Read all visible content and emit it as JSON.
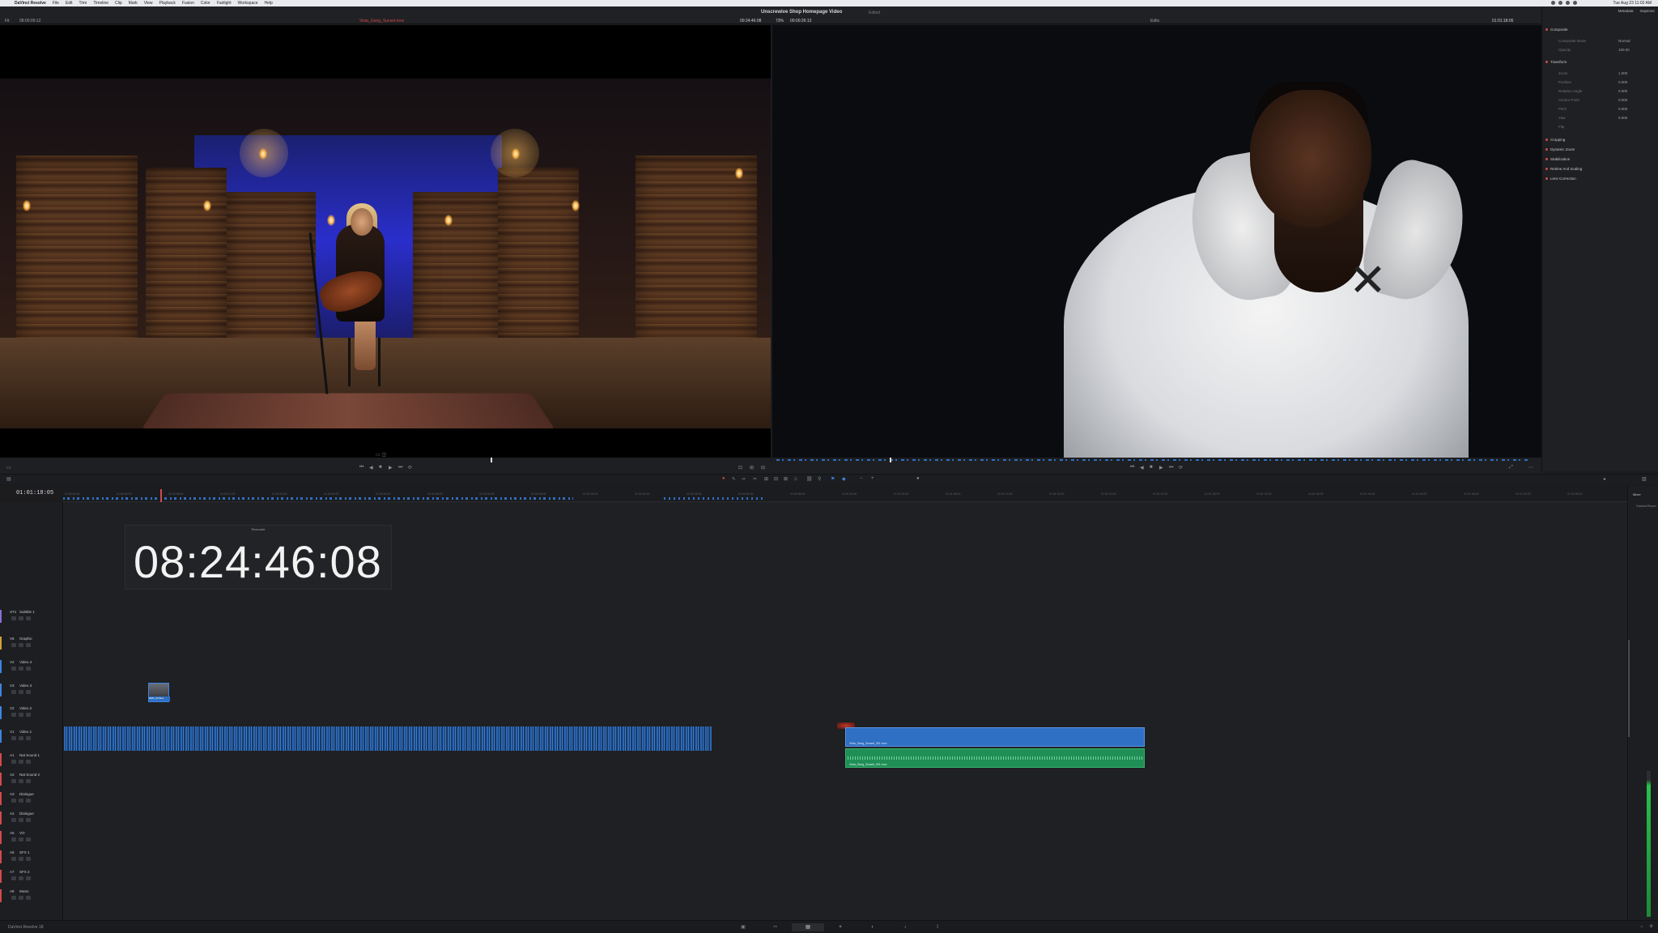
{
  "menubar": {
    "apple": "",
    "app_name": "DaVinci Resolve",
    "items": [
      "File",
      "Edit",
      "Trim",
      "Timeline",
      "Clip",
      "Mark",
      "View",
      "Playback",
      "Fusion",
      "Color",
      "Fairlight",
      "Workspace",
      "Help"
    ],
    "clock": "Tue Aug 23 11:02 AM"
  },
  "viewer": {
    "project_title": "Unscrewive Shop Homepage Video",
    "project_subtitle": "Edited",
    "source_fit": "Fit",
    "source_timecode": "08:00:09:12",
    "source_clip": "Vista_Gang_Sunset.mov",
    "source_duration": "00:24:46:08",
    "timeline_zoom": "73%",
    "timeline_timecode": "00:00:26:13",
    "timeline_name": "Edits",
    "timeline_tc_right": "01:01:18:05"
  },
  "inspector": {
    "tabs": [
      "Metadata",
      "Inspector"
    ],
    "sections": [
      {
        "label": "Composite"
      },
      {
        "label": "Transform"
      },
      {
        "label": "Cropping"
      },
      {
        "label": "Dynamic Zoom"
      },
      {
        "label": "Stabilization"
      },
      {
        "label": "Retime And Scaling"
      },
      {
        "label": "Lens Correction"
      }
    ],
    "rows": [
      {
        "label": "Composite Mode",
        "value": "Normal"
      },
      {
        "label": "Opacity",
        "value": "100.00"
      },
      {
        "label": "Zoom",
        "value": "1.000"
      },
      {
        "label": "Position",
        "value": "0.000"
      },
      {
        "label": "Rotation Angle",
        "value": "0.000"
      },
      {
        "label": "Anchor Point",
        "value": "0.000"
      },
      {
        "label": "Pitch",
        "value": "0.000"
      },
      {
        "label": "Yaw",
        "value": "0.000"
      },
      {
        "label": "Flip",
        "value": ""
      }
    ]
  },
  "timeline": {
    "current_timecode": "01:01:18:05",
    "overlay_label": "Timecode",
    "overlay_timecode": "08:24:46:08",
    "ruler_ticks": [
      "01:00:00:00",
      "01:00:04:00",
      "01:00:08:00",
      "01:00:12:00",
      "01:00:16:00",
      "01:00:20:00",
      "01:00:24:00",
      "01:00:28:00",
      "01:00:32:00",
      "01:00:36:00",
      "01:00:40:00",
      "01:00:44:00",
      "01:00:48:00",
      "01:00:52:00",
      "01:00:56:00",
      "01:01:00:00",
      "01:01:04:00",
      "01:01:08:00",
      "01:01:12:00",
      "01:01:16:00",
      "01:01:20:00",
      "01:01:24:00",
      "01:01:28:00",
      "01:01:32:00",
      "01:01:36:00",
      "01:01:40:00",
      "01:01:44:00",
      "01:01:48:00",
      "01:01:52:00",
      "01:01:56:00",
      "01:02:00:00",
      "01:02:04:00",
      "01:02:08:00",
      "01:02:12:00",
      "01:02:16:00",
      "01:02:20:00",
      "01:02:24:00",
      "01:02:28:00",
      "01:02:32:00"
    ],
    "tracks": [
      {
        "id": "ST1",
        "name": "Subtitle 1",
        "color": "#8a6fd1"
      },
      {
        "id": "V6",
        "name": "Graphic",
        "color": "#d1a13a"
      },
      {
        "id": "V4",
        "name": "Video 4",
        "color": "#3d84e0"
      },
      {
        "id": "V3",
        "name": "Video 3",
        "color": "#3d84e0"
      },
      {
        "id": "V2",
        "name": "Video 2",
        "color": "#3d84e0"
      },
      {
        "id": "V1",
        "name": "Video 1",
        "color": "#3d84e0"
      },
      {
        "id": "A1",
        "name": "Nat Sound 1",
        "color": "#d24a4a"
      },
      {
        "id": "A2",
        "name": "Nat Sound 2",
        "color": "#d24a4a"
      },
      {
        "id": "A3",
        "name": "Dialogue",
        "color": "#d24a4a"
      },
      {
        "id": "A4",
        "name": "Dialogue",
        "color": "#d24a4a"
      },
      {
        "id": "A5",
        "name": "VO",
        "color": "#d24a4a"
      },
      {
        "id": "A6",
        "name": "SFX 1",
        "color": "#d24a4a"
      },
      {
        "id": "A7",
        "name": "SFX 2",
        "color": "#d24a4a"
      },
      {
        "id": "A8",
        "name": "Music",
        "color": "#d24a4a"
      }
    ],
    "thumb_clip_label": "0001_03.SLA",
    "video_clip_name": "Vista_Gang_Sunset_001.mov",
    "audio_clip_name": "Vista_Gang_Sunset_001.mov"
  },
  "mixer": {
    "title": "Mixer",
    "bus": "Control Room"
  },
  "bottom": {
    "brand": "DaVinci Resolve 18",
    "pages": [
      "Media",
      "Cut",
      "Edit",
      "Fusion",
      "Color",
      "Fairlight",
      "Deliver"
    ],
    "active_page": "Edit"
  }
}
